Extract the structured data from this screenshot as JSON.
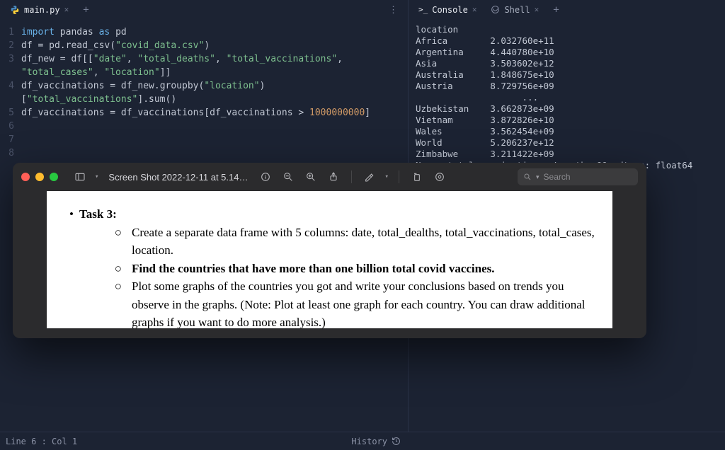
{
  "editor_tabs": {
    "main": {
      "label": "main.py"
    }
  },
  "code_lines": [
    {
      "n": "1",
      "html": "<span class='tok-kw'>import</span> <span class='tok-mod'>pandas</span> <span class='tok-kw'>as</span> <span class='tok-mod'>pd</span>"
    },
    {
      "n": "2",
      "html": "<span class='tok-var'>df</span> <span class='tok-op'>=</span> <span class='tok-var'>pd</span><span class='tok-punc'>.</span><span class='tok-fn'>read_csv</span><span class='tok-punc'>(</span><span class='tok-str'>\"covid_data.csv\"</span><span class='tok-punc'>)</span>"
    },
    {
      "n": "3",
      "html": "<span class='tok-var'>df_new</span> <span class='tok-op'>=</span> <span class='tok-var'>df</span><span class='tok-punc'>[[</span><span class='tok-str'>\"date\"</span><span class='tok-punc'>,</span> <span class='tok-str'>\"total_deaths\"</span><span class='tok-punc'>,</span> <span class='tok-str'>\"total_vaccinations\"</span><span class='tok-punc'>,</span>"
    },
    {
      "n": "",
      "html": "<span class='tok-str'>\"total_cases\"</span><span class='tok-punc'>,</span> <span class='tok-str'>\"location\"</span><span class='tok-punc'>]]</span>"
    },
    {
      "n": "4",
      "html": "<span class='tok-var'>df_vaccinations</span> <span class='tok-op'>=</span> <span class='tok-var'>df_new</span><span class='tok-punc'>.</span><span class='tok-fn'>groupby</span><span class='tok-punc'>(</span><span class='tok-str'>\"location\"</span><span class='tok-punc'>)</span>"
    },
    {
      "n": "",
      "html": "<span class='tok-punc'>[</span><span class='tok-str'>\"total_vaccinations\"</span><span class='tok-punc'>].</span><span class='tok-fn'>sum</span><span class='tok-punc'>()</span>"
    },
    {
      "n": "5",
      "html": "<span class='tok-var'>df_vaccinations</span> <span class='tok-op'>=</span> <span class='tok-var'>df_vaccinations</span><span class='tok-punc'>[</span><span class='tok-var'>df_vaccinations</span> <span class='tok-op'>&gt;</span> <span class='tok-num'>1000000000</span><span class='tok-punc'>]</span>"
    },
    {
      "n": "6",
      "html": ""
    },
    {
      "n": "7",
      "html": ""
    },
    {
      "n": "8",
      "html": ""
    }
  ],
  "console_tabs": {
    "console": {
      "label": "Console"
    },
    "shell": {
      "label": "Shell"
    }
  },
  "console_output": {
    "header": "location",
    "rows_top": [
      {
        "loc": "Africa",
        "val": "2.032760e+11"
      },
      {
        "loc": "Argentina",
        "val": "4.440780e+10"
      },
      {
        "loc": "Asia",
        "val": "3.503602e+12"
      },
      {
        "loc": "Australia",
        "val": "1.848675e+10"
      },
      {
        "loc": "Austria",
        "val": "8.729756e+09"
      }
    ],
    "ellipsis": "...",
    "rows_bottom": [
      {
        "loc": "Uzbekistan",
        "val": "3.662873e+09"
      },
      {
        "loc": "Vietnam",
        "val": "3.872826e+10"
      },
      {
        "loc": "Wales",
        "val": "3.562454e+09"
      },
      {
        "loc": "World",
        "val": "5.206237e+12"
      },
      {
        "loc": "Zimbabwe",
        "val": "3.211422e+09"
      }
    ],
    "footer": "Name: total_vaccinations, Length: 99, dtype: float64"
  },
  "status": {
    "cursor": "Line 6 : Col 1",
    "history": "History"
  },
  "preview": {
    "title": "Screen Shot 2022-12-11 at 5.14…",
    "search_placeholder": "Search",
    "task_label": "Task 3:",
    "sub_a": "Create a separate data frame with 5 columns: date, total_dealths, total_vaccinations, total_cases, location.",
    "sub_b": "Find the countries that have more than one billion total covid vaccines.",
    "sub_c": "Plot some graphs of the countries you got and write your conclusions based on trends you observe in the graphs. (Note: Plot at least one graph for each country. You can draw additional graphs if you want to do more analysis.)"
  }
}
